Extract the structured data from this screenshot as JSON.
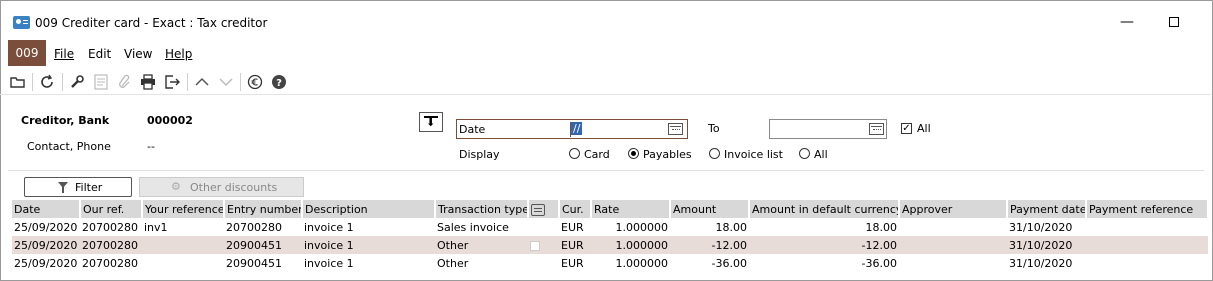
{
  "window": {
    "title": "009 Crediter card - Exact : Tax creditor",
    "minimize_symbol": "—",
    "icon": "app-card-icon"
  },
  "menu": {
    "badge": "009",
    "items": [
      {
        "label": "File",
        "underline": "F"
      },
      {
        "label": "Edit",
        "underline": "d"
      },
      {
        "label": "View",
        "underline": "w"
      },
      {
        "label": "Help",
        "underline": "H"
      }
    ]
  },
  "toolbar": {
    "icons": [
      "open-folder-icon",
      "refresh-icon",
      "wrench-icon",
      "notes-icon",
      "attach-icon",
      "print-icon",
      "export-icon",
      "up-icon",
      "down-icon",
      "euro-icon",
      "help-icon"
    ]
  },
  "header": {
    "creditor_label": "Creditor, Bank",
    "creditor_value": "000002",
    "contact_label": "Contact, Phone",
    "contact_value": "--",
    "date_label": "Date",
    "date_value": "//",
    "to_label": "To",
    "all_label": "All",
    "all_checked": true,
    "display_label": "Display",
    "display_options": [
      {
        "label": "Card",
        "selected": false
      },
      {
        "label": "Payables",
        "selected": true
      },
      {
        "label": "Invoice list",
        "selected": false
      },
      {
        "label": "All",
        "selected": false
      }
    ]
  },
  "buttons": {
    "filter": "Filter",
    "filter_underline": "i",
    "other_discounts": "Other discounts"
  },
  "table": {
    "columns": [
      "Date",
      "Our ref.",
      "Your reference",
      "Entry number",
      "Description",
      "Transaction type",
      "",
      "Cur.",
      "Rate",
      "Amount",
      "Amount in default currency",
      "Approver",
      "Payment date",
      "Payment reference"
    ],
    "rows": [
      {
        "date": "25/09/2020",
        "our_ref": "20700280",
        "your_ref": "inv1",
        "entry": "20700280",
        "desc": "invoice 1",
        "type": "Sales invoice",
        "cur": "EUR",
        "rate": "1.000000",
        "amount": "18.00",
        "amount_default": "18.00",
        "approver": "",
        "pay_date": "31/10/2020",
        "pay_ref": ""
      },
      {
        "date": "25/09/2020",
        "our_ref": "20700280",
        "your_ref": "",
        "entry": "20900451",
        "desc": "invoice 1",
        "type": "Other",
        "cur": "EUR",
        "rate": "1.000000",
        "amount": "-12.00",
        "amount_default": "-12.00",
        "approver": "",
        "pay_date": "31/10/2020",
        "pay_ref": ""
      },
      {
        "date": "25/09/2020",
        "our_ref": "20700280",
        "your_ref": "",
        "entry": "20900451",
        "desc": "invoice 1",
        "type": "Other",
        "cur": "EUR",
        "rate": "1.000000",
        "amount": "-36.00",
        "amount_default": "-36.00",
        "approver": "",
        "pay_date": "31/10/2020",
        "pay_ref": ""
      }
    ]
  },
  "colors": {
    "accent": "#7a4e3b",
    "selected_row": "#e8dcd8",
    "header_bg": "#d8d8d8",
    "selection": "#3466b0"
  }
}
